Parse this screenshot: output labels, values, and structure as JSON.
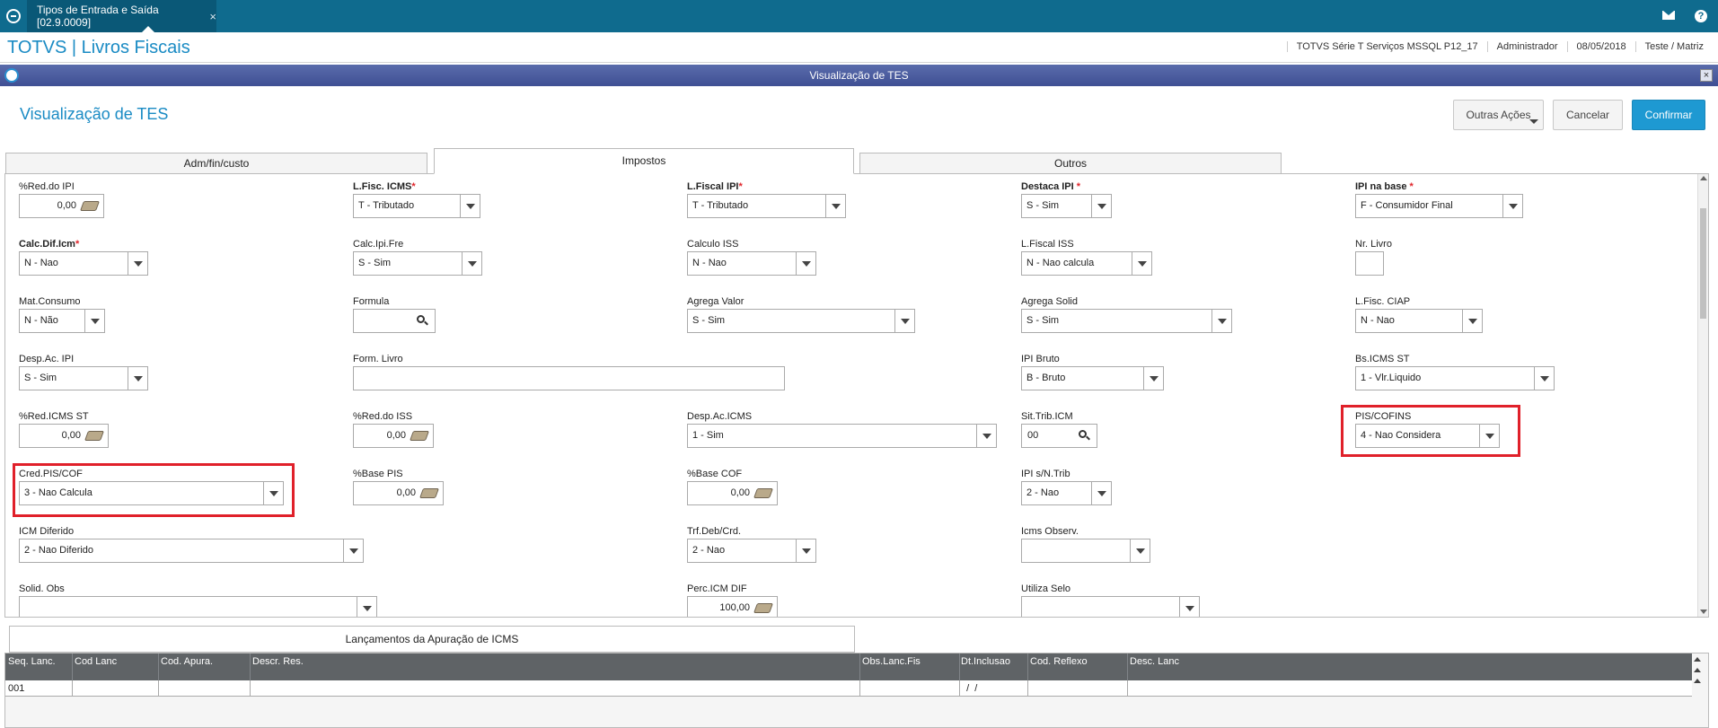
{
  "topbar": {
    "tab_title": "Tipos de Entrada e Saída [02.9.0009]",
    "tab_close": "×"
  },
  "header": {
    "brand": "TOTVS | Livros Fiscais",
    "system": "TOTVS Série T Serviços MSSQL P12_17",
    "user": "Administrador",
    "date": "08/05/2018",
    "company": "Teste / Matriz"
  },
  "dialog": {
    "title": "Visualização de TES",
    "close": "×"
  },
  "page": {
    "title": "Visualização de TES"
  },
  "actions": {
    "outras": "Outras Ações",
    "cancelar": "Cancelar",
    "confirmar": "Confirmar"
  },
  "tabs": [
    "Adm/fin/custo",
    "Impostos",
    "Outros"
  ],
  "fields": {
    "red_ipi": {
      "label": "%Red.do IPI",
      "value": "0,00"
    },
    "lfisc_icms": {
      "label": "L.Fisc. ICMS",
      "value": "T - Tributado"
    },
    "lfiscal_ipi": {
      "label": "L.Fiscal IPI",
      "value": "T - Tributado"
    },
    "destaca_ipi": {
      "label": "Destaca IPI",
      "value": "S - Sim"
    },
    "ipi_base": {
      "label": "IPI na base",
      "value": "F - Consumidor Final"
    },
    "calc_dif_icm": {
      "label": "Calc.Dif.Icm",
      "value": "N - Nao"
    },
    "calc_ipi_fre": {
      "label": "Calc.Ipi.Fre",
      "value": "S - Sim"
    },
    "calculo_iss": {
      "label": "Calculo ISS",
      "value": "N - Nao"
    },
    "lfiscal_iss": {
      "label": "L.Fiscal ISS",
      "value": "N - Nao calcula"
    },
    "nr_livro": {
      "label": "Nr. Livro",
      "value": ""
    },
    "mat_consumo": {
      "label": "Mat.Consumo",
      "value": "N - Não"
    },
    "formula": {
      "label": "Formula",
      "value": ""
    },
    "agrega_valor": {
      "label": "Agrega Valor",
      "value": "S - Sim"
    },
    "agrega_solid": {
      "label": "Agrega Solid",
      "value": "S - Sim"
    },
    "lfisc_ciap": {
      "label": "L.Fisc. CIAP",
      "value": "N - Nao"
    },
    "desp_ac_ipi": {
      "label": "Desp.Ac. IPI",
      "value": "S - Sim"
    },
    "form_livro": {
      "label": "Form. Livro",
      "value": ""
    },
    "ipi_bruto": {
      "label": "IPI Bruto",
      "value": "B - Bruto"
    },
    "bs_icms_st": {
      "label": "Bs.ICMS ST",
      "value": "1 - Vlr.Liquido"
    },
    "red_icms_st": {
      "label": "%Red.ICMS ST",
      "value": "0,00"
    },
    "red_iss": {
      "label": "%Red.do ISS",
      "value": "0,00"
    },
    "desp_ac_icms": {
      "label": "Desp.Ac.ICMS",
      "value": "1 - Sim"
    },
    "sit_trib_icm": {
      "label": "Sit.Trib.ICM",
      "value": "00"
    },
    "pis_cofins": {
      "label": "PIS/COFINS",
      "value": "4 - Nao Considera"
    },
    "cred_pis_cof": {
      "label": "Cred.PIS/COF",
      "value": "3 - Nao Calcula"
    },
    "base_pis": {
      "label": "%Base PIS",
      "value": "0,00"
    },
    "base_cof": {
      "label": "%Base COF",
      "value": "0,00"
    },
    "ipi_sn_trib": {
      "label": "IPI s/N.Trib",
      "value": "2 - Nao"
    },
    "icm_diferido": {
      "label": "ICM Diferido",
      "value": "2 - Nao Diferido"
    },
    "trf_deb_crd": {
      "label": "Trf.Deb/Crd.",
      "value": "2 - Nao"
    },
    "icms_observ": {
      "label": "Icms Observ.",
      "value": ""
    },
    "solid_obs": {
      "label": "Solid. Obs",
      "value": ""
    },
    "perc_icm_dif": {
      "label": "Perc.ICM DIF",
      "value": "100,00"
    },
    "utiliza_selo": {
      "label": "Utiliza Selo",
      "value": ""
    }
  },
  "grid": {
    "tab": "Lançamentos da Apuração de ICMS",
    "columns": [
      "Seq. Lanc.",
      "Cod Lanc",
      "Cod. Apura.",
      "Descr. Res.",
      "Obs.Lanc.Fis",
      "Dt.Inclusao",
      "Cod. Reflexo",
      "Desc. Lanc"
    ],
    "rows": [
      [
        "001",
        "",
        "",
        "",
        "",
        "  /  /",
        "",
        ""
      ]
    ]
  },
  "colors": {
    "topbar": "#0f6b8e",
    "brand": "#1a8bc4",
    "primary_button": "#1e99d2",
    "highlight": "#e0202a",
    "grid_header": "#5f6366"
  },
  "icons": [
    "totvs-logo-icon",
    "mail-icon",
    "help-icon",
    "calculator-icon",
    "search-icon",
    "dropdown-arrow-icon"
  ]
}
